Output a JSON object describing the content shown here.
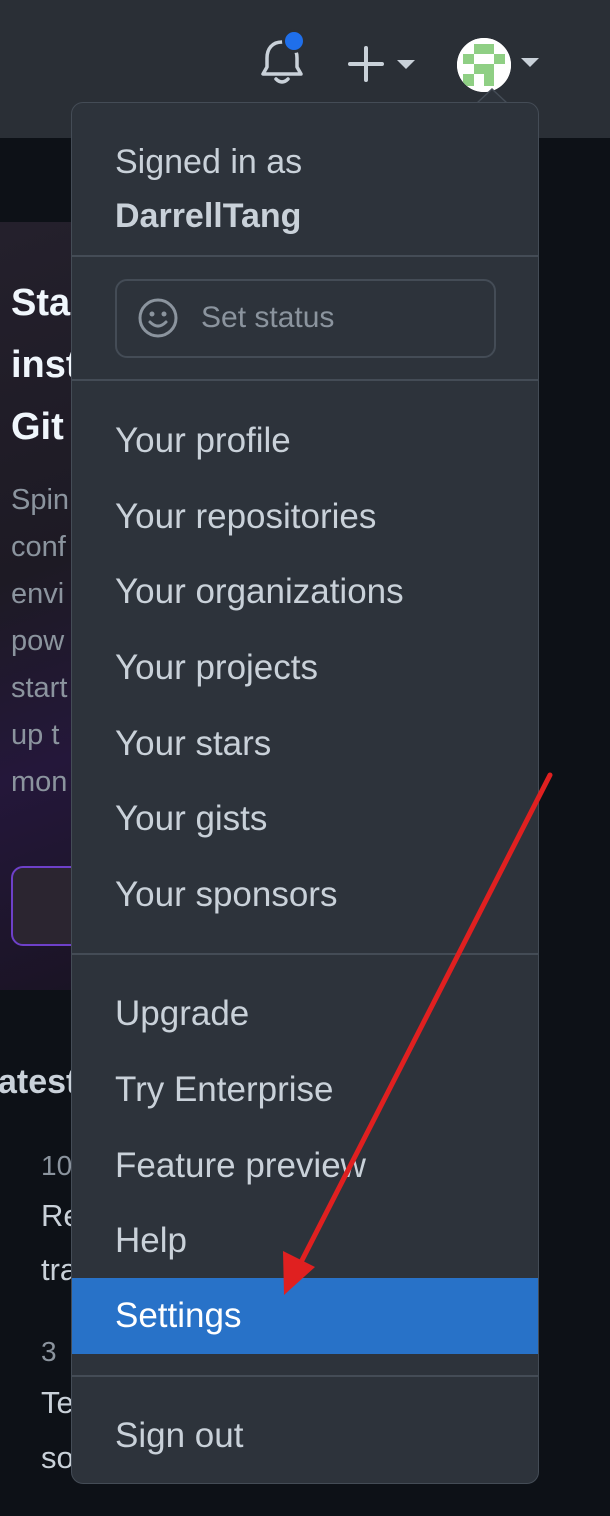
{
  "header": {
    "bell_icon": "bell-icon",
    "new_icon": "plus-icon",
    "colors": {
      "header_bg": "#2a2f36",
      "notification_dot": "#1f6feb"
    }
  },
  "background": {
    "card_title_lines": [
      "Sta",
      "inst",
      "Git"
    ],
    "card_body_lines": [
      "Spin",
      "conf",
      "envi",
      "pow",
      "start",
      "up t",
      "mon"
    ],
    "section_title": "atest",
    "items": [
      {
        "meta": "10",
        "line1": "Re",
        "line2": "tra"
      },
      {
        "meta": "3",
        "line1": "Te",
        "line2": "so"
      }
    ]
  },
  "menu": {
    "signed_in_label": "Signed in as",
    "username": "DarrellTang",
    "set_status_label": "Set status",
    "profile_items": [
      "Your profile",
      "Your repositories",
      "Your organizations",
      "Your projects",
      "Your stars",
      "Your gists",
      "Your sponsors"
    ],
    "misc_items": [
      "Upgrade",
      "Try Enterprise",
      "Feature preview",
      "Help",
      "Settings"
    ],
    "active_item": "Settings",
    "sign_out_label": "Sign out",
    "colors": {
      "menu_bg": "#2d333b",
      "active_bg": "#2872c8",
      "annotation_arrow": "#e02020"
    }
  }
}
